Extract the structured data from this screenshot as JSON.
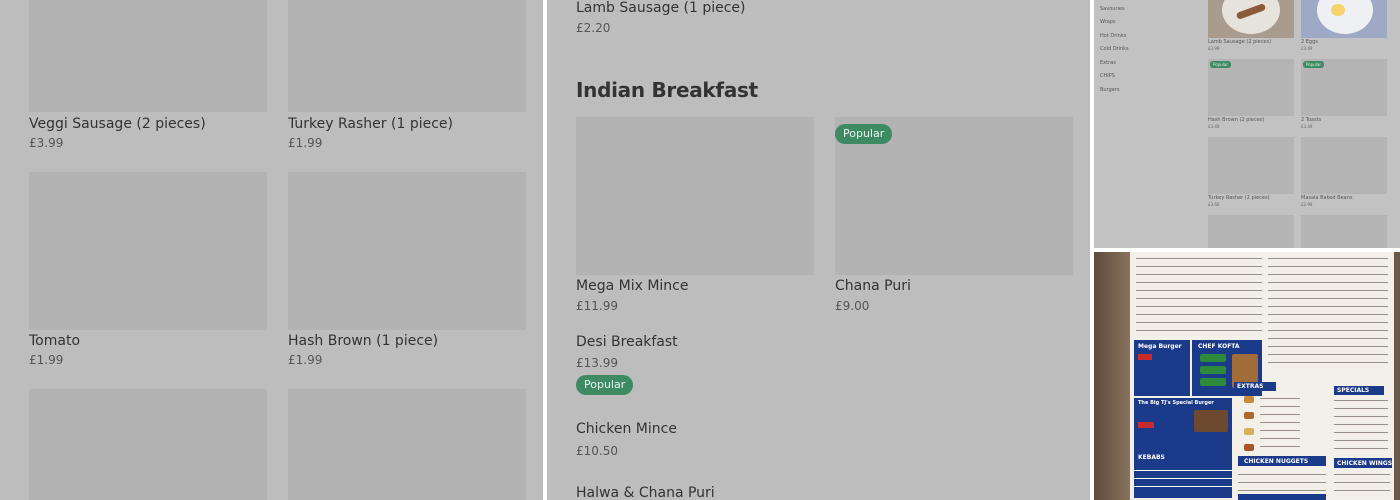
{
  "panel_left": {
    "items": [
      {
        "name": "Veggi Sausage (2 pieces)",
        "price": "£3.99"
      },
      {
        "name": "Turkey Rasher (1 piece)",
        "price": "£1.99"
      },
      {
        "name": "Tomato",
        "price": "£1.99"
      },
      {
        "name": "Hash Brown (1 piece)",
        "price": "£1.99"
      }
    ]
  },
  "panel_middle": {
    "top_item": {
      "name": "Lamb Sausage (1 piece)",
      "price": "£2.20"
    },
    "section_title": "Indian Breakfast",
    "items": [
      {
        "name": "Mega Mix Mince",
        "price": "£11.99"
      },
      {
        "name": "Chana Puri",
        "price": "£9.00",
        "badge": "Popular"
      },
      {
        "name": "Desi Breakfast",
        "price": "£13.99",
        "badge": "Popular"
      },
      {
        "name": "Chicken Mince",
        "price": "£10.50"
      },
      {
        "name": "Halwa & Chana Puri"
      }
    ]
  },
  "panel_thumb": {
    "categories": [
      "Savouries",
      "Wraps",
      "Hot Drinks",
      "Cold Drinks",
      "Extras",
      "CHIPS",
      "Burgers"
    ],
    "items": [
      {
        "name": "Lamb Sausage (2 pieces)",
        "price": "£3.99"
      },
      {
        "name": "2 Eggs",
        "price": "£3.49"
      },
      {
        "name": "Hash Brown (2 pieces)",
        "price": "£3.49",
        "badge": "Popular"
      },
      {
        "name": "2 Toasts",
        "price": "£3.49",
        "badge": "Popular"
      },
      {
        "name": "Turkey Rasher (2 pieces)",
        "price": "£3.60"
      },
      {
        "name": "Masala Baked Beans",
        "price": "£2.99"
      }
    ]
  },
  "panel_menu_photo": {
    "boxes": {
      "mega_burger": "Mega Burger",
      "chef_kofta": "CHEF KOFTA",
      "special_burger": "The Big TJ's Special Burger",
      "kebabs": "KEBABS",
      "extras": "EXTRAS",
      "specials": "SPECIALS",
      "chicken_nuggets": "CHICKEN NUGGETS",
      "chicken_wings": "CHICKEN WINGS"
    }
  },
  "colors": {
    "badge": "#3e8a63",
    "panel_bg": "#bdbdbd",
    "board_blue": "#1c3a8a"
  }
}
